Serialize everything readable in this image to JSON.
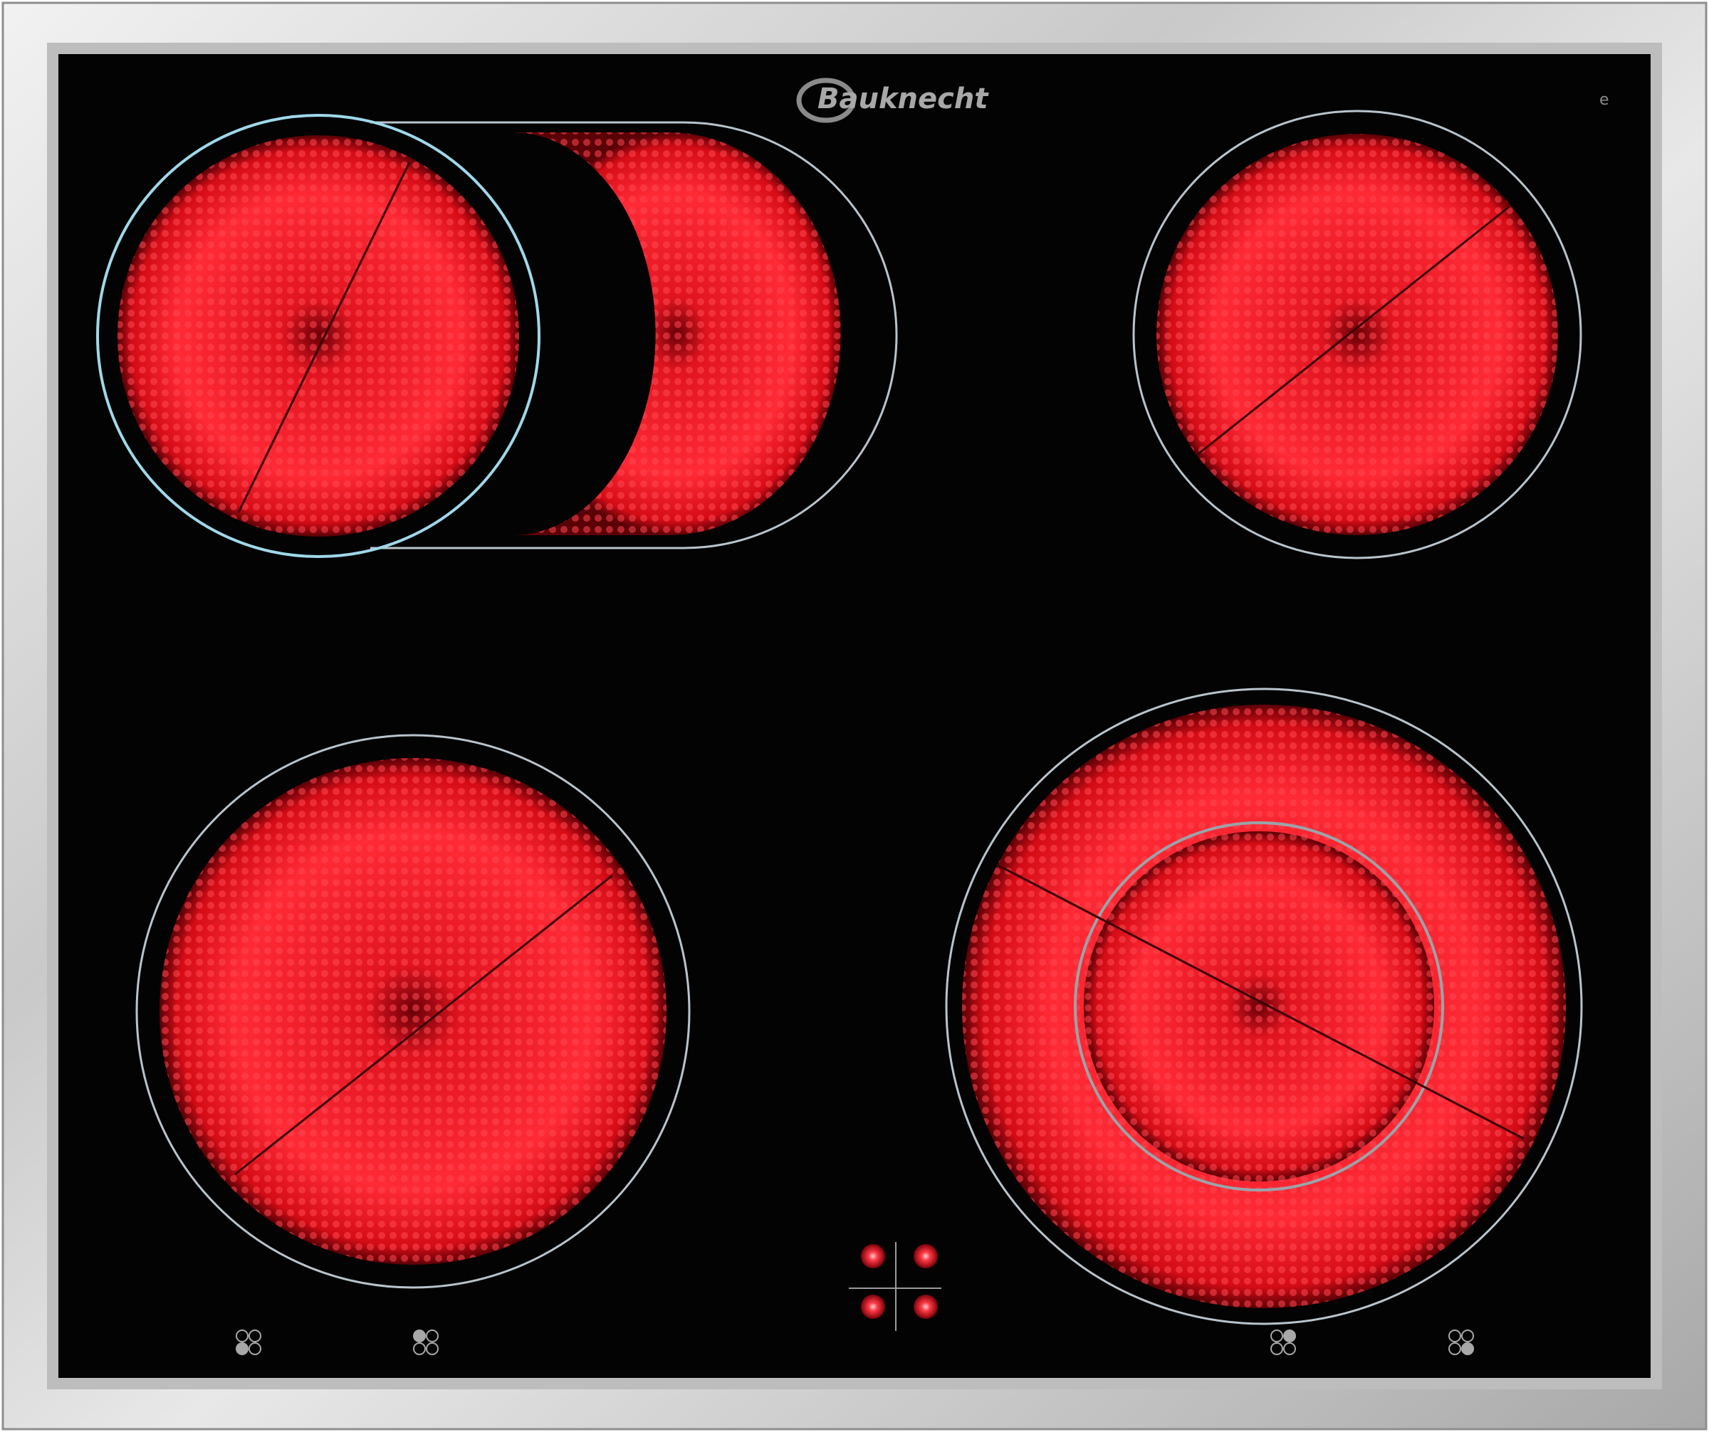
{
  "brand": {
    "name": "Bauknecht",
    "mark": "e"
  },
  "colors": {
    "frame_light": "#e6e6e6",
    "frame_dark": "#9c9c9c",
    "glass": "#030303",
    "heat_bright": "#ff2a36",
    "heat_mid": "#d40c16",
    "heat_dark": "#3a0003",
    "outline": "#b8c4cc",
    "indicator": "#ff3b46"
  },
  "cooking_zones": [
    {
      "id": "front-left",
      "state": "on"
    },
    {
      "id": "back-left-dual-oval",
      "state": "on"
    },
    {
      "id": "back-right",
      "state": "on"
    },
    {
      "id": "front-right-dual-circle",
      "state": "on"
    }
  ],
  "indicator_lights": {
    "count": 4,
    "state": "lit"
  },
  "zone_symbols": {
    "count": 4,
    "icon": "zone-position-icon"
  }
}
